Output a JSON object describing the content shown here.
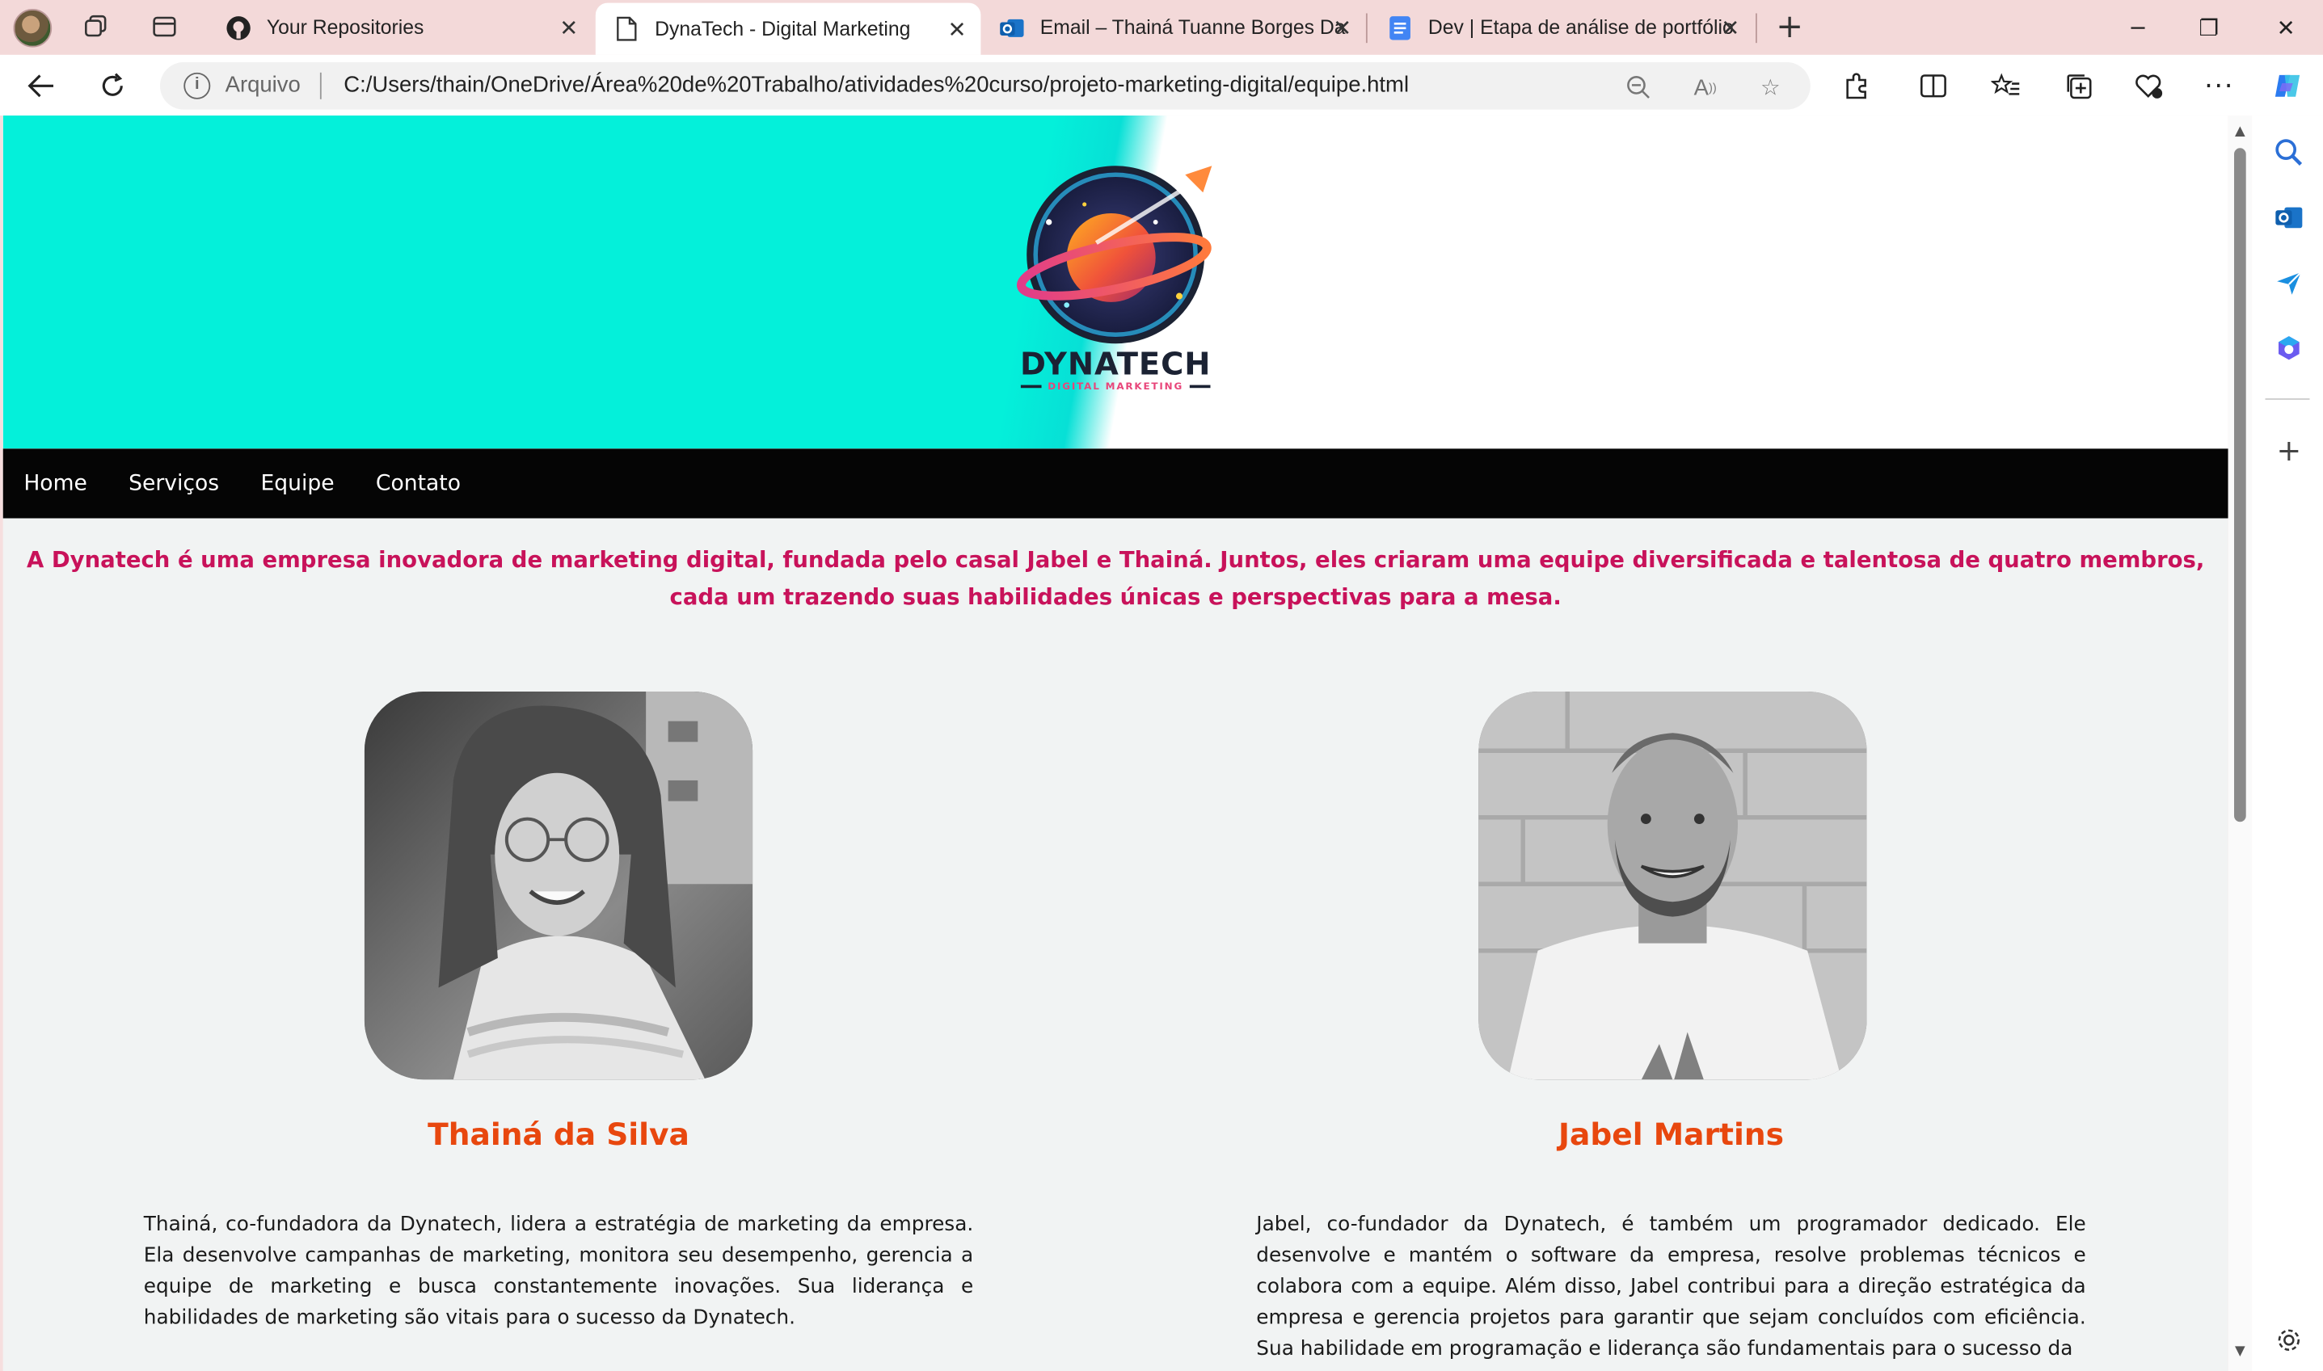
{
  "browser": {
    "tabs": [
      {
        "title": "Your Repositories",
        "icon": "github-icon",
        "active": false
      },
      {
        "title": "DynaTech - Digital Marketing",
        "icon": "page-icon",
        "active": true
      },
      {
        "title": "Email – Thainá Tuanne Borges Da",
        "icon": "outlook-icon",
        "active": false
      },
      {
        "title": "Dev | Etapa de análise de portfólio",
        "icon": "docs-icon",
        "active": false
      }
    ],
    "address": {
      "scheme_label": "Arquivo",
      "url": "C:/Users/thain/OneDrive/Área%20de%20Trabalho/atividades%20curso/projeto-marketing-digital/equipe.html"
    }
  },
  "site": {
    "logo": {
      "name": "DYNATECH",
      "tagline": "DIGITAL MARKETING"
    },
    "nav": [
      {
        "label": "Home"
      },
      {
        "label": "Serviços"
      },
      {
        "label": "Equipe"
      },
      {
        "label": "Contato"
      }
    ],
    "intro": "A Dynatech é uma empresa inovadora de marketing digital, fundada pelo casal Jabel e Thainá. Juntos, eles criaram uma equipe diversificada e talentosa de quatro membros, cada um trazendo suas habilidades únicas e perspectivas para a mesa.",
    "members": [
      {
        "name": "Thainá da Silva",
        "bio": "Thainá, co-fundadora da Dynatech, lidera a estratégia de marketing da empresa. Ela desenvolve campanhas de marketing, monitora seu desempenho, gerencia a equipe de marketing e busca constantemente inovações. Sua liderança e habilidades de marketing são vitais para o sucesso da Dynatech."
      },
      {
        "name": "Jabel Martins",
        "bio": "Jabel, co-fundador da Dynatech, é também um programador dedicado. Ele desenvolve e mantém o software da empresa, resolve problemas técnicos e colabora com a equipe. Além disso, Jabel contribui para a direção estratégica da empresa e gerencia projetos para garantir que sejam concluídos com eficiência. Sua habilidade em programação e liderança são fundamentais para o sucesso da"
      }
    ]
  },
  "colors": {
    "hero_cyan": "#04f0da",
    "nav_bg": "#050505",
    "intro_text": "#c8125a",
    "member_name": "#e8470e",
    "tab_strip": "#f3d9d9"
  }
}
